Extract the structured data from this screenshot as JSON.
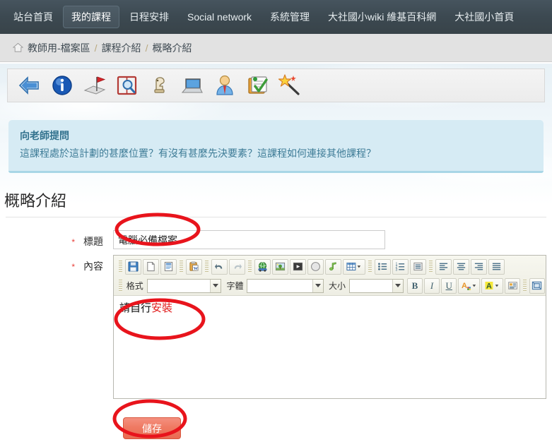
{
  "nav": {
    "items": [
      {
        "label": "站台首頁",
        "active": false
      },
      {
        "label": "我的課程",
        "active": true
      },
      {
        "label": "日程安排",
        "active": false
      },
      {
        "label": "Social network",
        "active": false
      },
      {
        "label": "系統管理",
        "active": false
      },
      {
        "label": "大社國小wiki 維基百科網",
        "active": false
      },
      {
        "label": "大社國小首頁",
        "active": false
      }
    ]
  },
  "breadcrumb": {
    "home_icon": "home-icon",
    "items": [
      "教師用-檔案區",
      "課程介紹",
      "概略介紹"
    ],
    "separator": "/"
  },
  "toolbar": {
    "icons": [
      {
        "name": "back-arrow-icon",
        "title": "返回"
      },
      {
        "name": "info-icon",
        "title": "資訊"
      },
      {
        "name": "milestone-flag-icon",
        "title": "里程碑"
      },
      {
        "name": "book-search-icon",
        "title": "查詢"
      },
      {
        "name": "chess-piece-icon",
        "title": "策略"
      },
      {
        "name": "laptop-icon",
        "title": "電腦"
      },
      {
        "name": "user-icon",
        "title": "使用者"
      },
      {
        "name": "checklist-icon",
        "title": "檢核表"
      },
      {
        "name": "magic-wand-icon",
        "title": "精靈"
      }
    ]
  },
  "infobox": {
    "title": "向老師提問",
    "body": "這課程處於這計劃的甚麼位置？有沒有甚麼先決要素？這課程如何連接其他課程？"
  },
  "page": {
    "heading": "概略介紹"
  },
  "form": {
    "title_field": {
      "required_mark": "*",
      "label": "標題",
      "value": "電腦必備檔案",
      "placeholder": ""
    },
    "content_field": {
      "required_mark": "*",
      "label": "內容",
      "text_plain": "請自行",
      "text_red": "安裝"
    },
    "save_label": "儲存"
  },
  "editor": {
    "row1_buttons": [
      {
        "name": "save-icon",
        "title": "儲存"
      },
      {
        "name": "new-page-icon",
        "title": "新建"
      },
      {
        "name": "templates-icon",
        "title": "範本"
      },
      {
        "name": "paste-from-word-icon",
        "title": "從 Word 貼上"
      },
      {
        "name": "undo-icon",
        "title": "復原"
      },
      {
        "name": "redo-icon",
        "title": "重做"
      },
      {
        "name": "link-icon",
        "title": "超連結"
      },
      {
        "name": "image-icon",
        "title": "影像"
      },
      {
        "name": "flash-video-icon",
        "title": "影片"
      },
      {
        "name": "compass-icon",
        "title": "瀏覽"
      },
      {
        "name": "audio-note-icon",
        "title": "音訊"
      },
      {
        "name": "table-icon",
        "title": "表格"
      },
      {
        "name": "bulleted-list-icon",
        "title": "項目清單"
      },
      {
        "name": "numbered-list-icon",
        "title": "編號清單"
      },
      {
        "name": "blockquote-icon",
        "title": "區塊引言"
      },
      {
        "name": "align-left-icon",
        "title": "靠左對齊"
      },
      {
        "name": "align-center-icon",
        "title": "置中對齊"
      },
      {
        "name": "align-right-icon",
        "title": "靠右對齊"
      },
      {
        "name": "align-justify-icon",
        "title": "左右對齊"
      }
    ],
    "format_label": "格式",
    "format_value": "",
    "font_label": "字體",
    "font_value": "",
    "size_label": "大小",
    "size_value": "",
    "row2_buttons": [
      {
        "name": "bold-icon",
        "title": "粗體",
        "glyph": "B"
      },
      {
        "name": "italic-icon",
        "title": "斜體",
        "glyph": "I"
      },
      {
        "name": "underline-icon",
        "title": "底線",
        "glyph": "U"
      },
      {
        "name": "text-color-icon",
        "title": "文字顏色"
      },
      {
        "name": "background-color-icon",
        "title": "背景顏色"
      },
      {
        "name": "show-blocks-icon",
        "title": "顯示區塊"
      },
      {
        "name": "maximize-icon",
        "title": "最大化"
      }
    ]
  },
  "annotations": {
    "color": "#e8141c",
    "marks": [
      {
        "name": "annotation-ellipse-title",
        "target": "標題欄位"
      },
      {
        "name": "annotation-ellipse-content",
        "target": "內容文字"
      },
      {
        "name": "annotation-ellipse-save",
        "target": "儲存按鈕"
      }
    ]
  }
}
